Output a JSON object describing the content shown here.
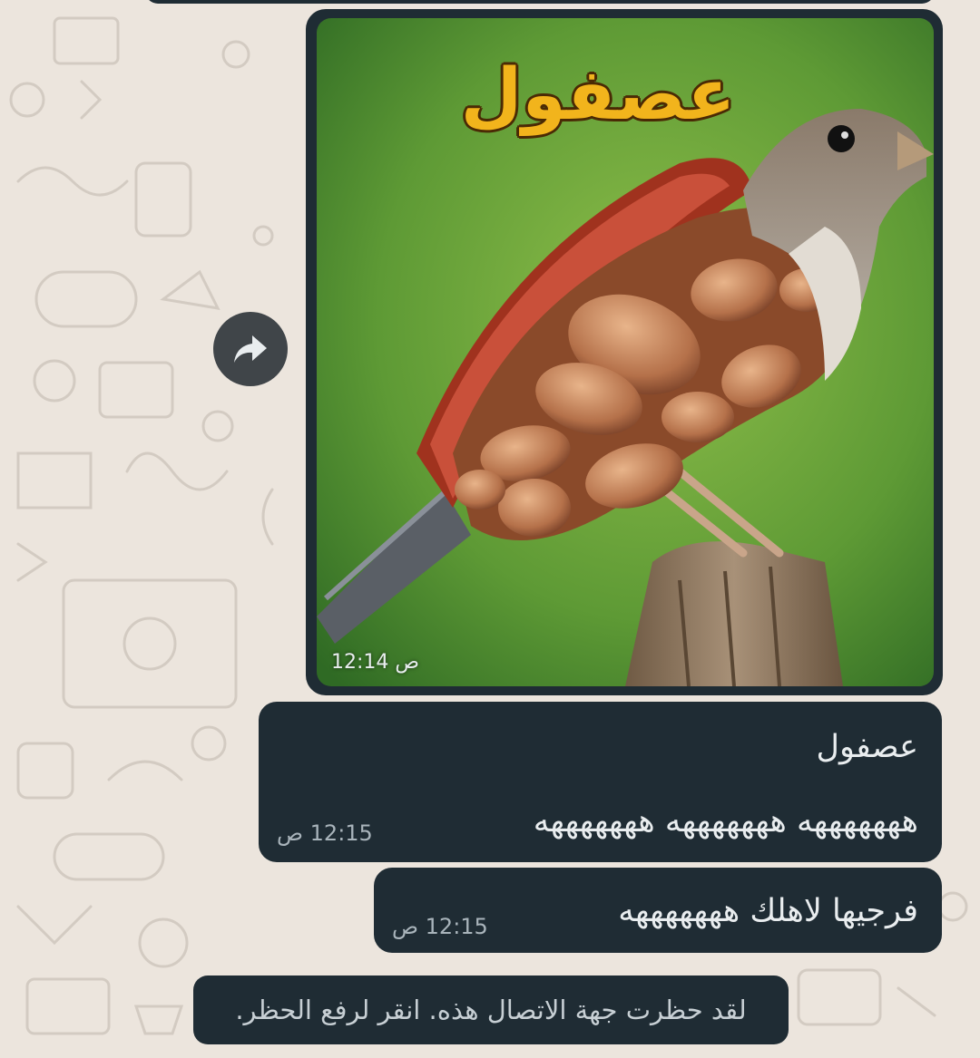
{
  "image_message": {
    "caption_overlay": "عصفول",
    "time": "12:14 ص"
  },
  "messages": [
    {
      "lines": [
        "عصفول",
        "هههههههه هههههههه هههههههه"
      ],
      "time": "12:15 ص"
    },
    {
      "lines": [
        "فرجيها لاهلك هههههههه"
      ],
      "time": "12:15 ص"
    }
  ],
  "system_notice": "لقد حظرت جهة الاتصال هذه. انقر لرفع الحظر.",
  "icons": {
    "forward": "forward-arrow-icon"
  },
  "colors": {
    "wallpaper": "#ece5dd",
    "bubble": "#1f2c34",
    "text": "#e9edef",
    "meta": "#a9b4bb",
    "caption_overlay": "#f2b41c"
  }
}
